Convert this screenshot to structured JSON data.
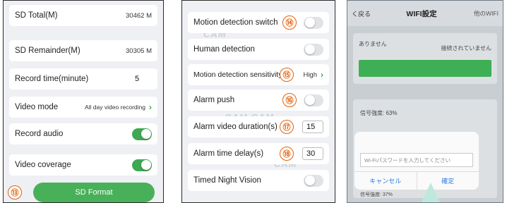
{
  "panel1": {
    "sd_total_label": "SD Total(M)",
    "sd_total_value": "30462 M",
    "sd_remainder_label": "SD Remainder(M)",
    "sd_remainder_value": "30305 M",
    "record_time_label": "Record time(minute)",
    "record_time_value": "5",
    "video_mode_label": "Video mode",
    "video_mode_value": "All day video recording",
    "record_audio_label": "Record audio",
    "record_audio_on": true,
    "video_coverage_label": "Video coverage",
    "video_coverage_on": true,
    "format_button": "SD Format",
    "badge": "⑬"
  },
  "panel2": {
    "motion_switch_label": "Motion detection switch",
    "motion_switch_badge": "⑭",
    "human_detection_label": "Human detection",
    "sensitivity_label": "Motion detection sensitivity",
    "sensitivity_badge": "⑮",
    "sensitivity_value": "High",
    "alarm_push_label": "Alarm push",
    "alarm_push_badge": "⑯",
    "alarm_video_label": "Alarm video duration(s)",
    "alarm_video_badge": "⑰",
    "alarm_video_value": "15",
    "alarm_delay_label": "Alarm time delay(s)",
    "alarm_delay_badge": "⑱",
    "alarm_delay_value": "30",
    "night_vision_label": "Timed Night Vision"
  },
  "panel3": {
    "back": "く戻る",
    "title": "WIFI設定",
    "other_wifi": "他のWIFI",
    "none": "ありません",
    "not_connected": "接続されていません",
    "signal_1": "信号強度: 63%",
    "password_placeholder": "Wi-Fiパスワードを入力してください",
    "cancel": "キャンセル",
    "confirm": "確定",
    "signal_2": "信号強度: 37%"
  },
  "colors": {
    "accent_green": "#3ea853",
    "badge_orange": "#e2610c",
    "connector_blue": "#1aa0c8"
  }
}
